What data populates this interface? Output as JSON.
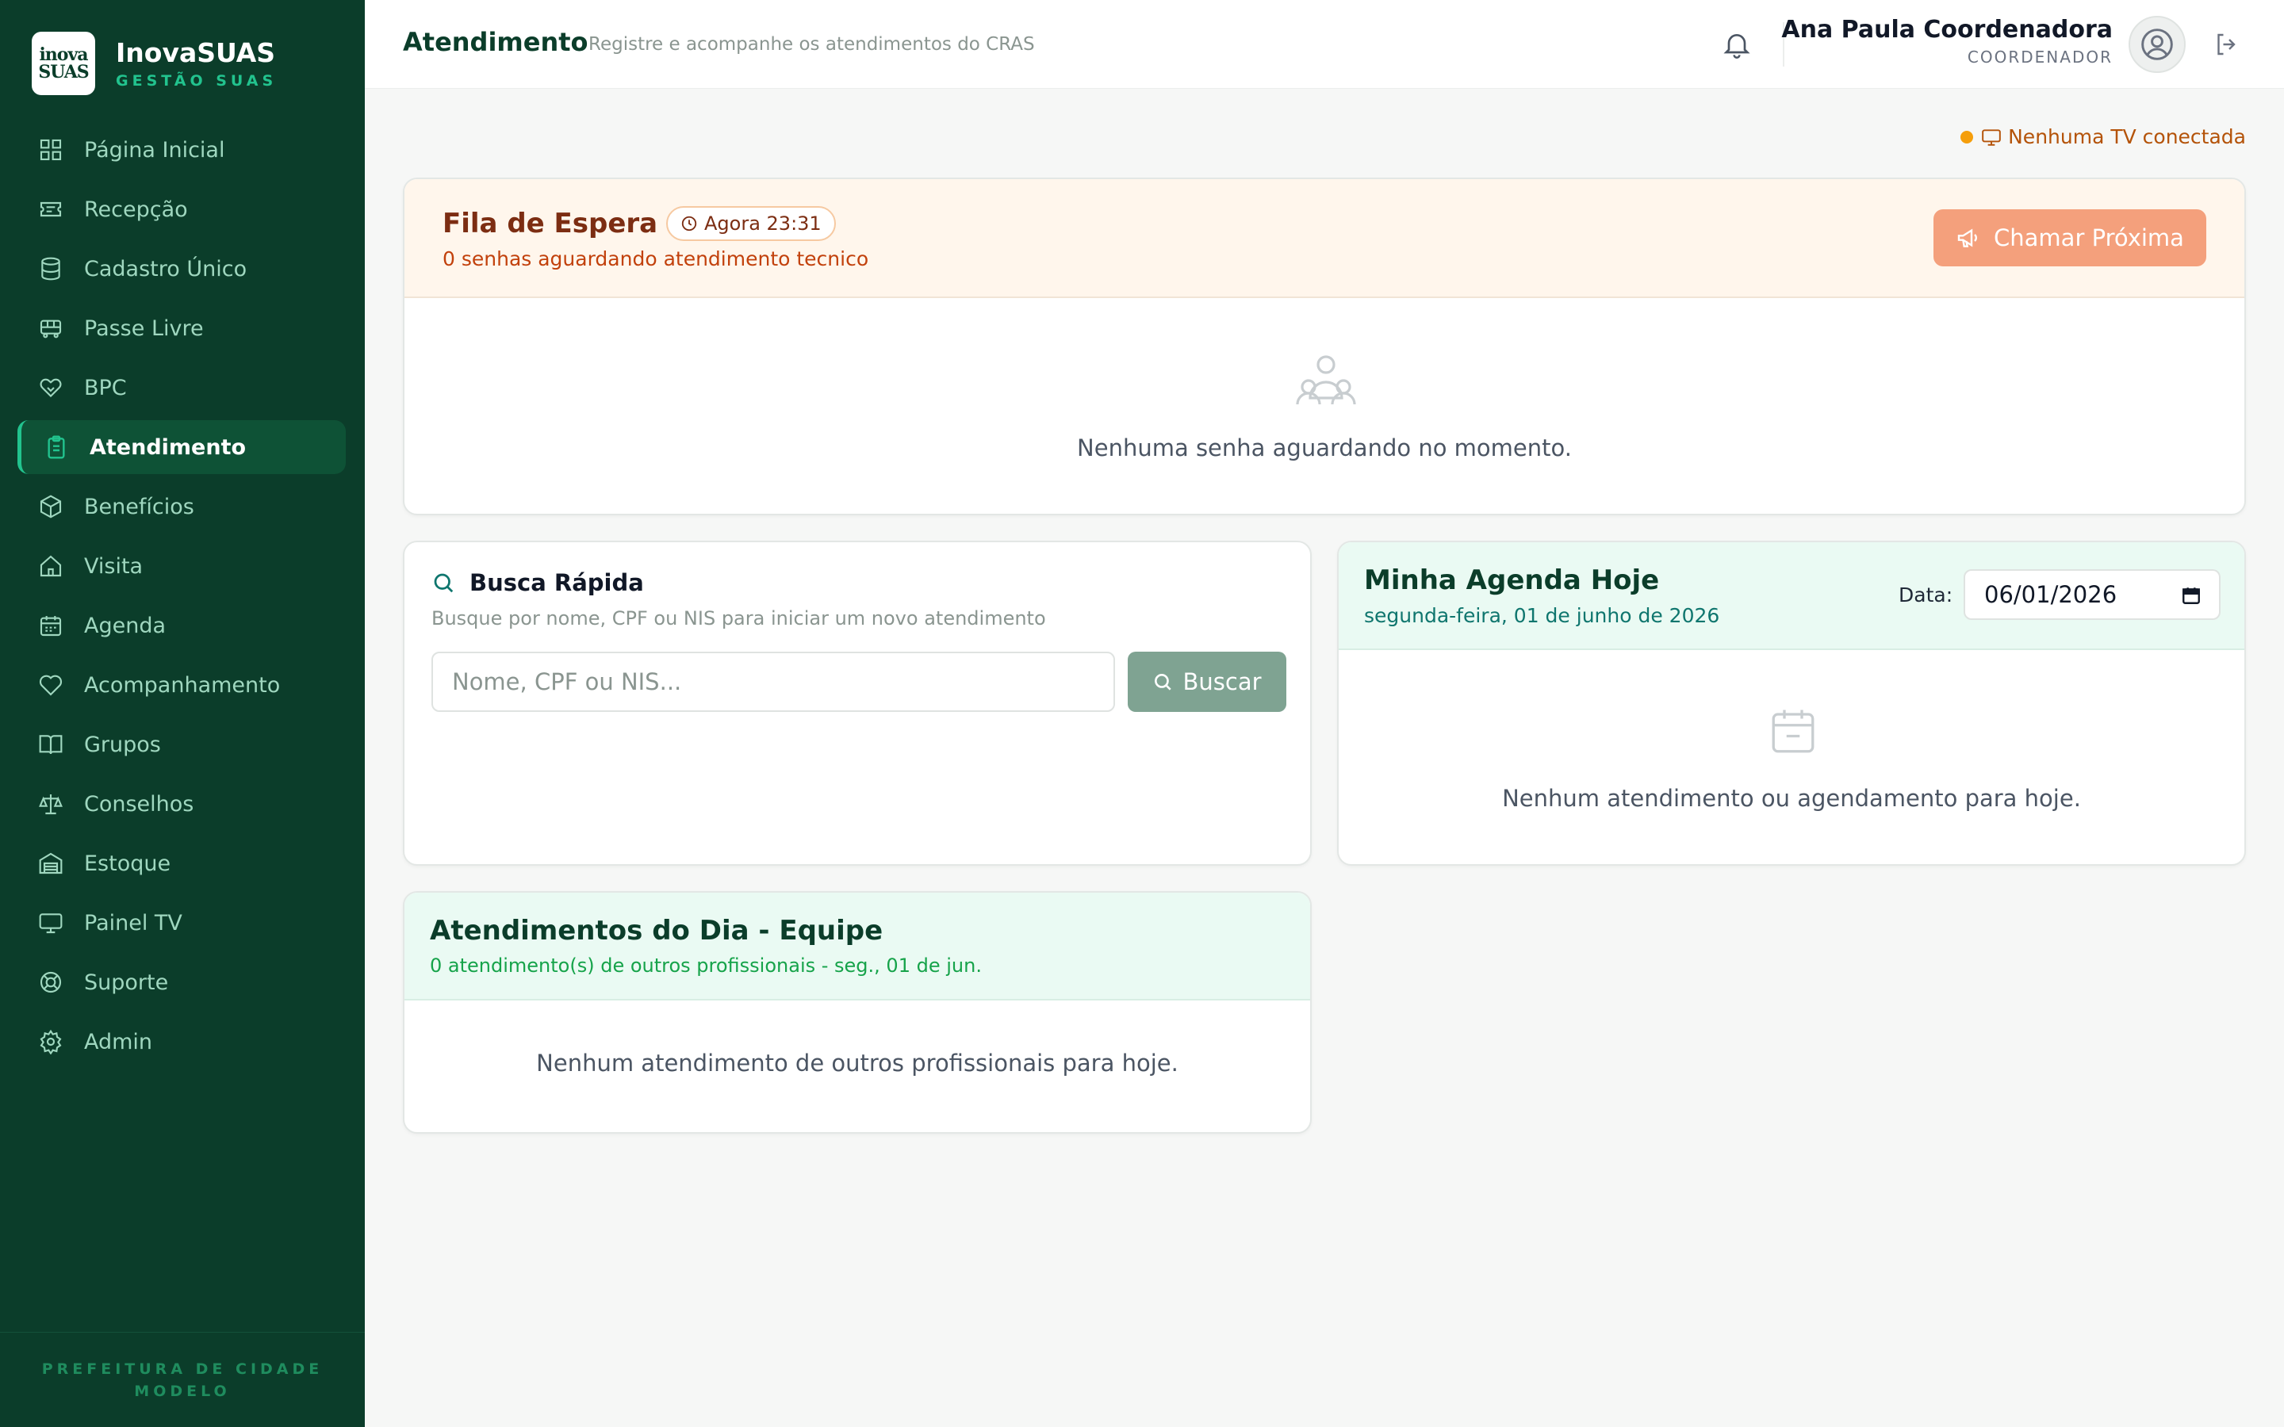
{
  "brand": {
    "logo_lines": [
      "inova",
      "SUAS"
    ],
    "name": "InovaSUAS",
    "subtitle": "GESTÃO SUAS"
  },
  "sidebar": {
    "items": [
      {
        "label": "Página Inicial",
        "icon": "grid-icon"
      },
      {
        "label": "Recepção",
        "icon": "ticket-icon"
      },
      {
        "label": "Cadastro Único",
        "icon": "database-icon"
      },
      {
        "label": "Passe Livre",
        "icon": "bus-icon"
      },
      {
        "label": "BPC",
        "icon": "handshake-icon"
      },
      {
        "label": "Atendimento",
        "icon": "clipboard-icon",
        "active": true
      },
      {
        "label": "Benefícios",
        "icon": "package-icon"
      },
      {
        "label": "Visita",
        "icon": "home-icon"
      },
      {
        "label": "Agenda",
        "icon": "calendar-icon"
      },
      {
        "label": "Acompanhamento",
        "icon": "heart-icon"
      },
      {
        "label": "Grupos",
        "icon": "book-icon"
      },
      {
        "label": "Conselhos",
        "icon": "scale-icon"
      },
      {
        "label": "Estoque",
        "icon": "warehouse-icon"
      },
      {
        "label": "Painel TV",
        "icon": "monitor-icon"
      },
      {
        "label": "Suporte",
        "icon": "lifebuoy-icon"
      },
      {
        "label": "Admin",
        "icon": "gear-icon"
      }
    ],
    "footer": "PREFEITURA DE CIDADE MODELO"
  },
  "header": {
    "title": "Atendimento",
    "subtitle": "Registre e acompanhe os atendimentos do CRAS",
    "user_name": "Ana Paula Coordenadora",
    "user_role": "COORDENADOR"
  },
  "tv_status": {
    "text": "Nenhuma TV conectada",
    "dot_color": "#f59e0b"
  },
  "queue": {
    "title": "Fila de Espera",
    "time_badge": "Agora 23:31",
    "subtitle": "0 senhas aguardando atendimento tecnico",
    "call_button": "Chamar Próxima",
    "empty_text": "Nenhuma senha aguardando no momento."
  },
  "search": {
    "title": "Busca Rápida",
    "subtitle": "Busque por nome, CPF ou NIS para iniciar um novo atendimento",
    "placeholder": "Nome, CPF ou NIS...",
    "button": "Buscar"
  },
  "agenda": {
    "title": "Minha Agenda Hoje",
    "subtitle": "segunda-feira, 01 de junho de 2026",
    "date_label": "Data:",
    "date_value": "06/01/2026",
    "empty_text": "Nenhum atendimento ou agendamento para hoje."
  },
  "team": {
    "title": "Atendimentos do Dia - Equipe",
    "subtitle": "0 atendimento(s) de outros profissionais - seg., 01 de jun.",
    "empty_text": "Nenhum atendimento de outros profissionais para hoje."
  },
  "colors": {
    "sidebar_bg": "#0b3d2a",
    "accent_green": "#22c38e",
    "call_button": "#f4a07c",
    "search_button": "#7fa392"
  }
}
